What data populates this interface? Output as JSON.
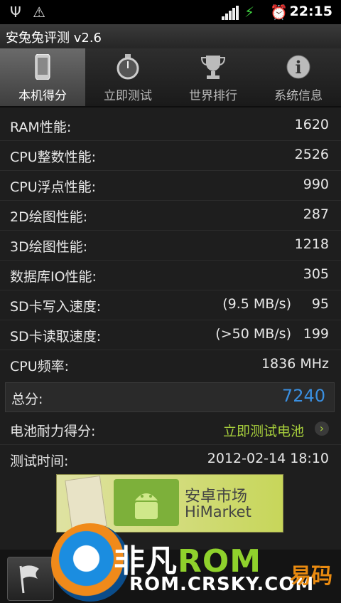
{
  "status_bar": {
    "time": "22:15"
  },
  "app_title": "安兔兔评测 v2.6",
  "tabs": [
    {
      "label": "本机得分",
      "icon": "phone-icon",
      "active": true
    },
    {
      "label": "立即测试",
      "icon": "stopwatch-icon",
      "active": false
    },
    {
      "label": "世界排行",
      "icon": "trophy-icon",
      "active": false
    },
    {
      "label": "系统信息",
      "icon": "info-icon",
      "active": false
    }
  ],
  "scores": [
    {
      "label": "RAM性能:",
      "value": "1620"
    },
    {
      "label": "CPU整数性能:",
      "value": "2526"
    },
    {
      "label": "CPU浮点性能:",
      "value": "990"
    },
    {
      "label": "2D绘图性能:",
      "value": "287"
    },
    {
      "label": "3D绘图性能:",
      "value": "1218"
    },
    {
      "label": "数据库IO性能:",
      "value": "305"
    },
    {
      "label": "SD卡写入速度:",
      "extra": "(9.5 MB/s)",
      "value": "95"
    },
    {
      "label": "SD卡读取速度:",
      "extra": "(>50 MB/s)",
      "value": "199"
    },
    {
      "label": "CPU频率:",
      "value": "1836 MHz"
    }
  ],
  "total": {
    "label": "总分:",
    "value": "7240"
  },
  "battery": {
    "label": "电池耐力得分:",
    "link": "立即测试电池"
  },
  "test_time": {
    "label": "测试时间:",
    "value": "2012-02-14 18:10"
  },
  "banner": {
    "line1": "安卓市场",
    "line2": "HiMarket"
  },
  "watermark": {
    "brand": "非凡",
    "rom": "ROM",
    "url": "ROM.CRSKY.COM",
    "right": "易码"
  },
  "colors": {
    "accent_blue": "#3a8fe0",
    "link_green": "#a7cf3c"
  }
}
